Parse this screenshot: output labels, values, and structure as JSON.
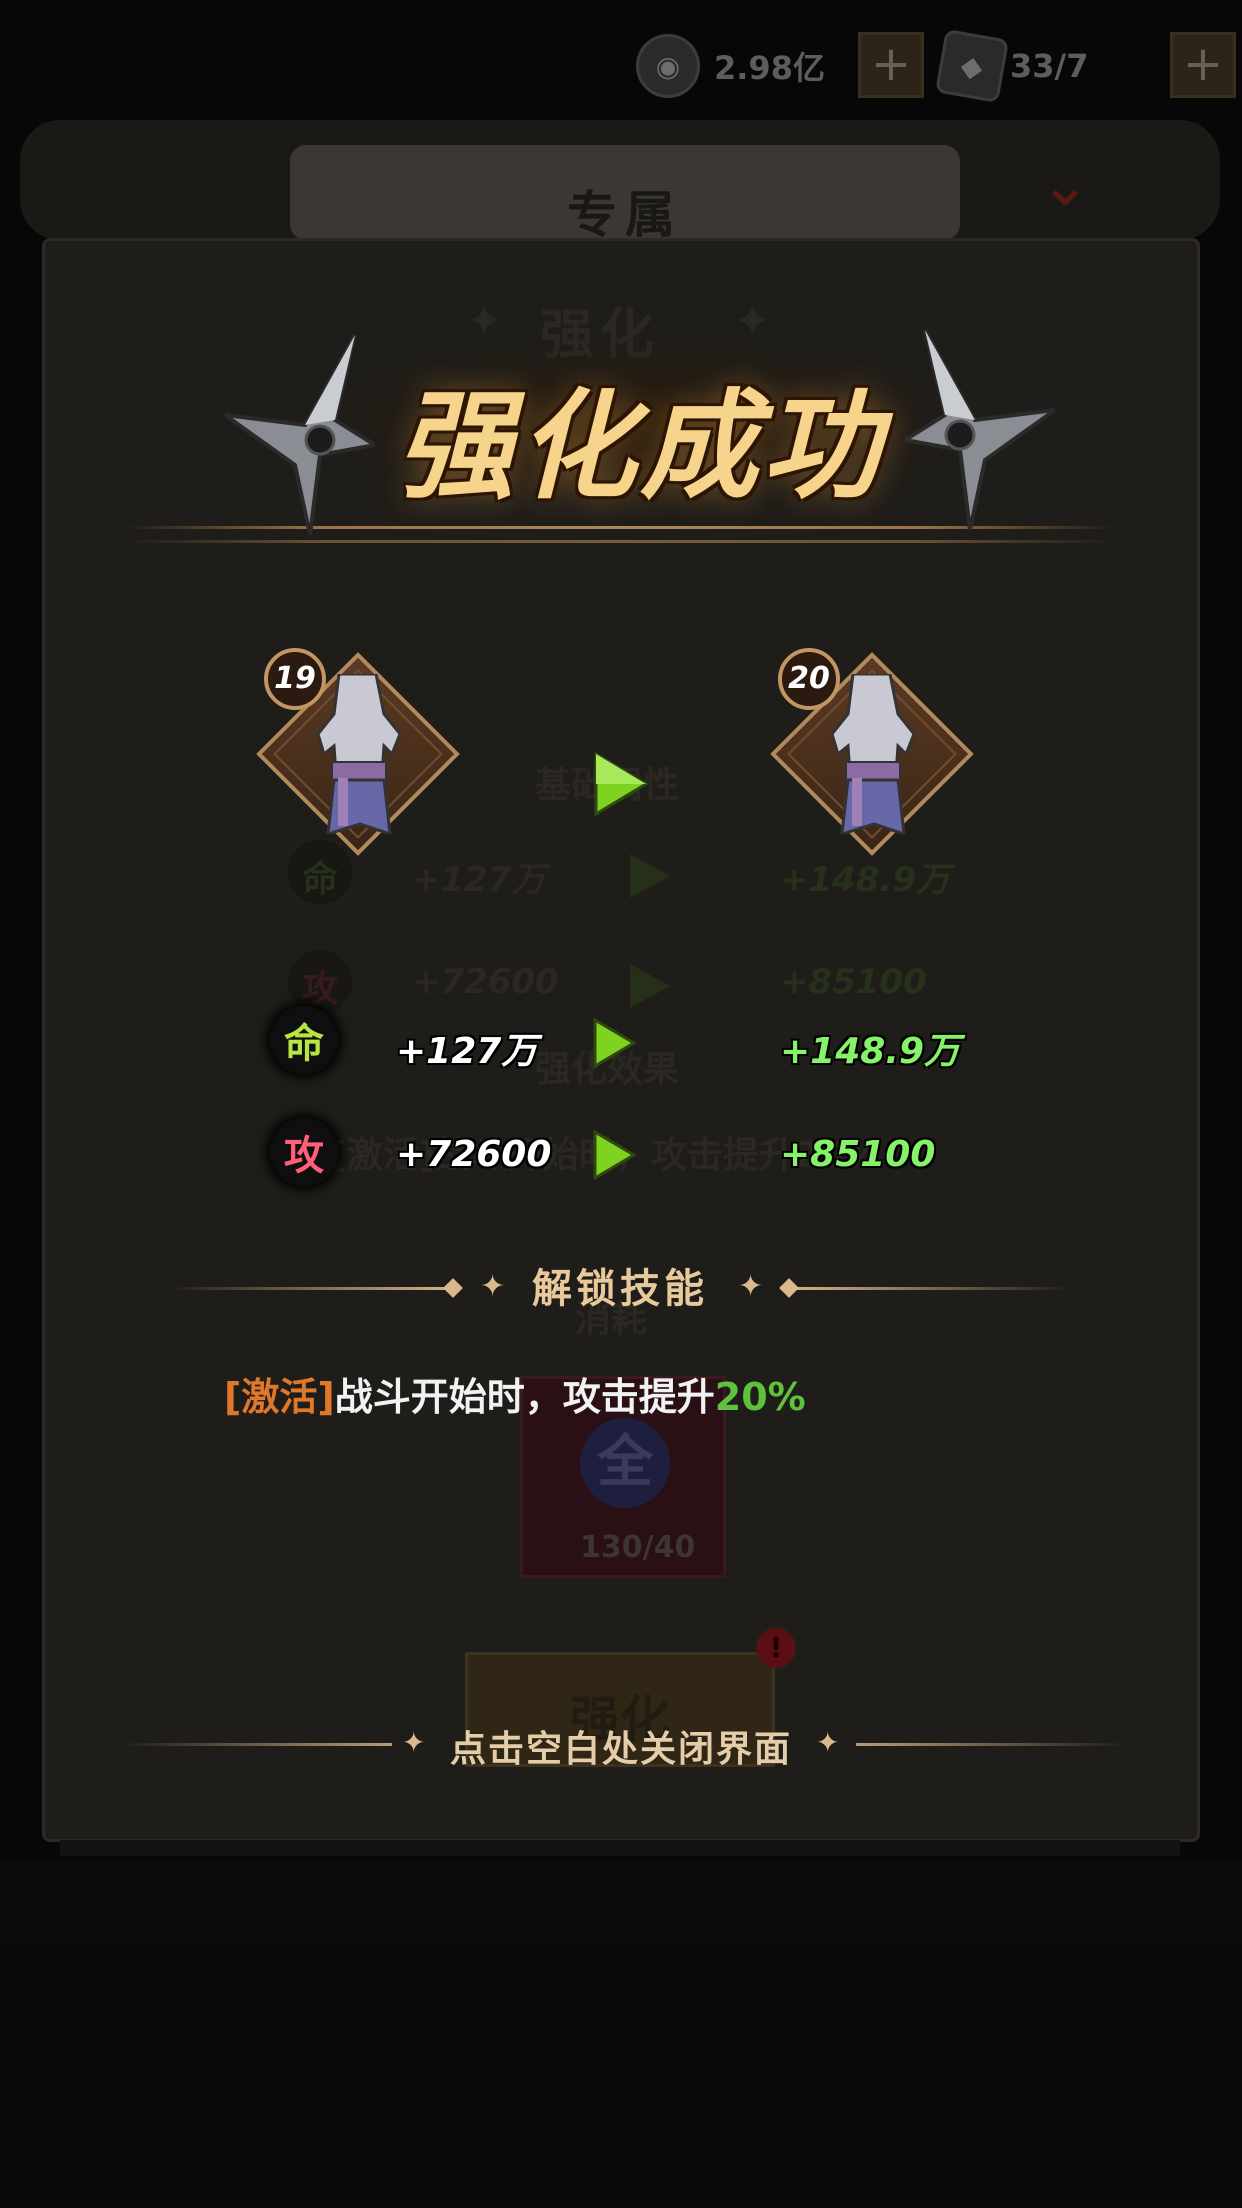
{
  "top_bar": {
    "coins_value": "2.98亿",
    "stamina_value": "33/7",
    "plus_label": "+"
  },
  "background": {
    "tab_title": "专属",
    "section_title": "强化",
    "base_attr_label": "基础属性",
    "stat_life_label": "命",
    "stat_life_from": "+127万",
    "stat_life_to": "+148.9万",
    "stat_attack_label": "攻",
    "stat_attack_from": "+72600",
    "stat_attack_to": "+85100",
    "effect_label": "强化效果",
    "effect_text": "[激活]战斗开始时，攻击提升20%",
    "consume_label": "消耗",
    "material_glyph": "全",
    "material_count": "130/40",
    "enhance_button": "强化",
    "alert_badge": "!"
  },
  "popup": {
    "title": "强化成功",
    "level_before": "19",
    "level_after": "20",
    "stats": [
      {
        "label": "命",
        "from": "+127万",
        "to": "+148.9万",
        "color": "#b8e640"
      },
      {
        "label": "攻",
        "from": "+72600",
        "to": "+85100",
        "color": "#ff5f78"
      }
    ],
    "unlock_title": "解锁技能",
    "skill": {
      "tag": "[激活]",
      "text": "战斗开始时，攻击提升",
      "value": "20%"
    },
    "close_hint": "点击空白处关闭界面"
  },
  "colors": {
    "accent_gold": "#f6d48b",
    "arrow_green": "#7ed321",
    "increase_green": "#86f26a",
    "skill_tag_orange": "#e0782c",
    "skill_value_green": "#5fc23c"
  }
}
